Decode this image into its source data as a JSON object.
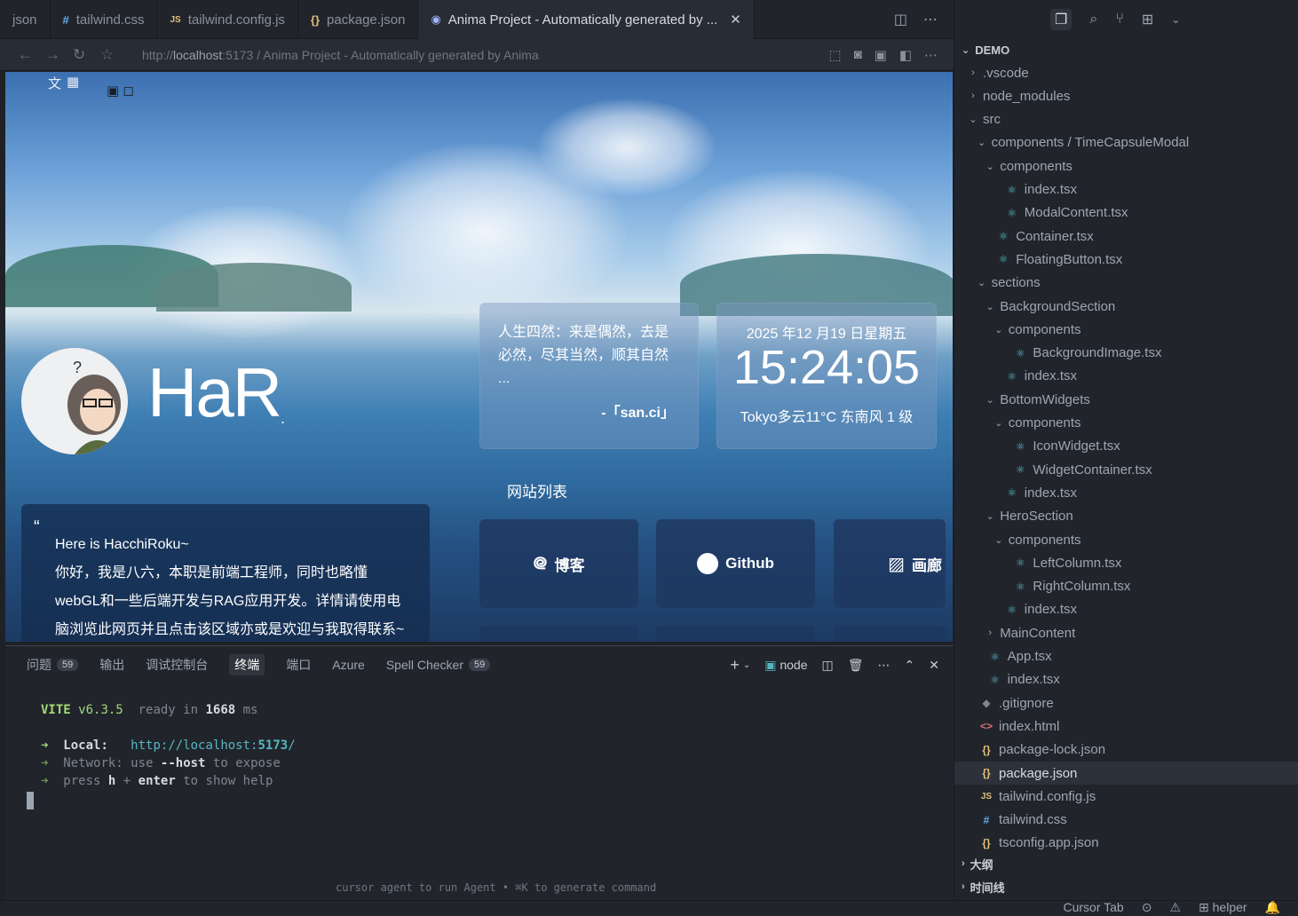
{
  "tabs": [
    {
      "label": "json",
      "icon": "",
      "active": false
    },
    {
      "label": "tailwind.css",
      "icon": "#",
      "active": false
    },
    {
      "label": "tailwind.config.js",
      "icon": "JS",
      "active": false
    },
    {
      "label": "package.json",
      "icon": "{}",
      "active": false
    },
    {
      "label": "Anima Project - Automatically generated by ...",
      "icon": "globe-icon",
      "active": true
    }
  ],
  "browser": {
    "url_prefix": "http://",
    "url_host": "localhost",
    "url_rest": ":5173 / Anima Project - Automatically generated by Anima"
  },
  "page": {
    "brand": "HaR",
    "brand_suffix": ".",
    "quote": "人生四然：来是偶然，去是必然，尽其当然，顺其自然 ...",
    "quote_author": "-「san.ci」",
    "clock_date": "2025 年12 月19 日星期五",
    "clock_time": "15:24:05",
    "clock_weather": "Tokyo多云11°C 东南风  1 级",
    "sites_title": "网站列表",
    "sites": [
      {
        "label": "博客",
        "icon": "blog-icon"
      },
      {
        "label": "Github",
        "icon": "github-icon"
      },
      {
        "label": "画廊",
        "icon": "gallery-icon"
      }
    ],
    "intro_mark": "“",
    "intro_lines": [
      "Here is HacchiRoku~",
      "你好，我是八六，本职是前端工程师，同时也略懂",
      "webGL和一些后端开发与RAG应用开发。详情请使用电",
      "脑浏览此网页并且点击该区域亦或是欢迎与我取得联系~"
    ]
  },
  "panel": {
    "tabs": [
      {
        "label": "问题",
        "badge": "59"
      },
      {
        "label": "输出",
        "badge": ""
      },
      {
        "label": "调试控制台",
        "badge": ""
      },
      {
        "label": "终端",
        "badge": "",
        "active": true
      },
      {
        "label": "端口",
        "badge": ""
      },
      {
        "label": "Azure",
        "badge": ""
      },
      {
        "label": "Spell Checker",
        "badge": "59"
      }
    ],
    "terminal_name": "node",
    "vite_name": "VITE",
    "vite_version": "v6.3.5",
    "ready_text": "ready in",
    "ready_ms": "1668",
    "ready_unit": "ms",
    "local_label": "Local:",
    "local_url_prefix": "http://localhost:",
    "local_port": "5173",
    "local_slash": "/",
    "network_label": "Network:",
    "network_use": "use",
    "network_flag": "--host",
    "network_rest": "to expose",
    "press_text": "press",
    "press_h": "h",
    "press_plus": "+",
    "press_enter": "enter",
    "press_rest": "to show help",
    "hint": "cursor  agent to run Agent • ⌘K to generate command"
  },
  "explorer": {
    "root": "DEMO",
    "rows": [
      {
        "depth": 1,
        "chev": "›",
        "icon": "",
        "label": ".vscode"
      },
      {
        "depth": 1,
        "chev": "›",
        "icon": "",
        "label": "node_modules"
      },
      {
        "depth": 1,
        "chev": "⌄",
        "icon": "",
        "label": "src"
      },
      {
        "depth": 2,
        "chev": "⌄",
        "icon": "",
        "label": "components / TimeCapsuleModal"
      },
      {
        "depth": 3,
        "chev": "⌄",
        "icon": "",
        "label": "components"
      },
      {
        "depth": 4,
        "chev": "",
        "icon": "react",
        "label": "index.tsx"
      },
      {
        "depth": 4,
        "chev": "",
        "icon": "react",
        "label": "ModalContent.tsx"
      },
      {
        "depth": 3,
        "chev": "",
        "icon": "react",
        "label": "Container.tsx"
      },
      {
        "depth": 3,
        "chev": "",
        "icon": "react",
        "label": "FloatingButton.tsx"
      },
      {
        "depth": 2,
        "chev": "⌄",
        "icon": "",
        "label": "sections"
      },
      {
        "depth": 3,
        "chev": "⌄",
        "icon": "",
        "label": "BackgroundSection"
      },
      {
        "depth": 4,
        "chev": "⌄",
        "icon": "",
        "label": "components"
      },
      {
        "depth": 5,
        "chev": "",
        "icon": "react",
        "label": "BackgroundImage.tsx"
      },
      {
        "depth": 4,
        "chev": "",
        "icon": "react",
        "label": "index.tsx"
      },
      {
        "depth": 3,
        "chev": "⌄",
        "icon": "",
        "label": "BottomWidgets"
      },
      {
        "depth": 4,
        "chev": "⌄",
        "icon": "",
        "label": "components"
      },
      {
        "depth": 5,
        "chev": "",
        "icon": "react",
        "label": "IconWidget.tsx"
      },
      {
        "depth": 5,
        "chev": "",
        "icon": "react",
        "label": "WidgetContainer.tsx"
      },
      {
        "depth": 4,
        "chev": "",
        "icon": "react",
        "label": "index.tsx"
      },
      {
        "depth": 3,
        "chev": "⌄",
        "icon": "",
        "label": "HeroSection"
      },
      {
        "depth": 4,
        "chev": "⌄",
        "icon": "",
        "label": "components"
      },
      {
        "depth": 5,
        "chev": "",
        "icon": "react",
        "label": "LeftColumn.tsx"
      },
      {
        "depth": 5,
        "chev": "",
        "icon": "react",
        "label": "RightColumn.tsx"
      },
      {
        "depth": 4,
        "chev": "",
        "icon": "react",
        "label": "index.tsx"
      },
      {
        "depth": 3,
        "chev": "›",
        "icon": "",
        "label": "MainContent"
      },
      {
        "depth": 2,
        "chev": "",
        "icon": "react",
        "label": "App.tsx"
      },
      {
        "depth": 2,
        "chev": "",
        "icon": "react",
        "label": "index.tsx"
      },
      {
        "depth": 1,
        "chev": "",
        "icon": "git",
        "label": ".gitignore"
      },
      {
        "depth": 1,
        "chev": "",
        "icon": "html",
        "label": "index.html"
      },
      {
        "depth": 1,
        "chev": "",
        "icon": "json",
        "label": "package-lock.json"
      },
      {
        "depth": 1,
        "chev": "",
        "icon": "json",
        "label": "package.json",
        "selected": true
      },
      {
        "depth": 1,
        "chev": "",
        "icon": "js",
        "label": "tailwind.config.js"
      },
      {
        "depth": 1,
        "chev": "",
        "icon": "css",
        "label": "tailwind.css"
      },
      {
        "depth": 1,
        "chev": "",
        "icon": "json",
        "label": "tsconfig.app.json"
      }
    ],
    "outline": "大纲",
    "timeline": "时间线"
  },
  "status": {
    "cursor_tab": "Cursor Tab",
    "helper": "helper"
  },
  "colors": {
    "accent_react": "#56b6c2",
    "json_yellow": "#e5c07b",
    "vite_green": "#a3d977"
  }
}
